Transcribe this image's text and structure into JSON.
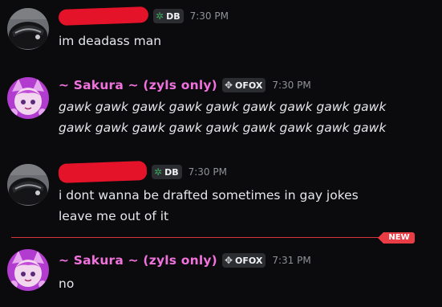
{
  "messages": [
    {
      "author_redacted": true,
      "tag": {
        "icon": "db-badge-icon",
        "text": "DB"
      },
      "time": "7:30 PM",
      "lines": [
        "im deadass man"
      ]
    },
    {
      "author": "~ Sakura ~ (zyls only)",
      "tag": {
        "icon": "ofox-badge-icon",
        "text": "OFOX"
      },
      "time": "7:30 PM",
      "lines": [
        "gawk gawk gawk gawk gawk gawk gawk gawk gawk",
        "gawk gawk gawk gawk gawk gawk gawk gawk gawk"
      ]
    },
    {
      "author_redacted": true,
      "tag": {
        "icon": "db-badge-icon",
        "text": "DB"
      },
      "time": "7:30 PM",
      "lines": [
        "i dont wanna be drafted sometimes in gay jokes",
        "leave me out of it"
      ]
    },
    {
      "author": "~ Sakura ~ (zyls only)",
      "tag": {
        "icon": "ofox-badge-icon",
        "text": "OFOX"
      },
      "time": "7:31 PM",
      "lines": [
        "no"
      ]
    }
  ],
  "new_divider": {
    "label": "NEW"
  },
  "colors": {
    "background": "#0b0b0d",
    "sakura_name": "#f072dd",
    "redaction": "#e4132a",
    "new_divider": "#ea3c45"
  }
}
